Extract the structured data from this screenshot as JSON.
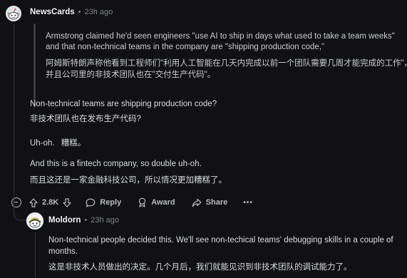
{
  "comment": {
    "author": "NewsCards",
    "separator": "•",
    "time": "23h ago",
    "quote_en_1": "Armstrong claimed he'd seen engineers \"use AI to ship in days what used to take a team weeks\"",
    "quote_en_2": "and that non-technical teams in the company are \"shipping production code,\"",
    "quote_zh_1": "阿姆斯特朗声称他看到工程师们\"利用人工智能在几天内完成以前一个团队需要几周才能完成的工作\"，",
    "quote_zh_2": "并且公司里的非技术团队也在\"交付生产代码\"。",
    "p1_en": "Non-technical teams are shipping production code?",
    "p1_zh": "非技术团队也在发布生产代码?",
    "p2_en": "Uh-oh.",
    "p2_zh": "糟糕。",
    "p3_en": "And this is a fintech company, so double uh-oh.",
    "p3_zh": "而且这还是一家金融科技公司，所以情况更加糟糕了。",
    "actions": {
      "vote_count": "2.8K",
      "reply_label": "Reply",
      "award_label": "Award",
      "share_label": "Share",
      "more_label": "•••"
    }
  },
  "reply": {
    "author": "Moldorn",
    "separator": "•",
    "time": "23h ago",
    "text_en_1": "Non-technical people decided this. We'll see non-techical teams' debugging skills in a couple of",
    "text_en_2": "months.",
    "text_zh": "这是非技术人员做出的决定。几个月后，我们就能见识到非技术团队的调试能力了。"
  },
  "colors": {
    "background": "#111114",
    "text": "#d7dadc",
    "meta": "#818384",
    "thread_line": "#343536"
  }
}
